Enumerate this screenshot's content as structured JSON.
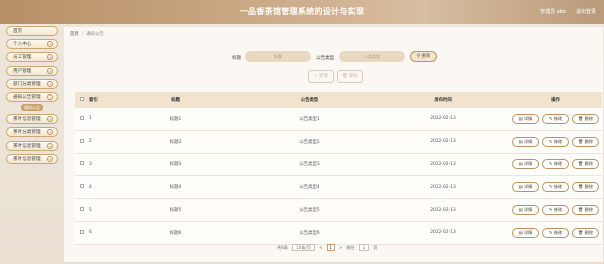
{
  "header": {
    "title": "一品香茶馆管理系统的设计与实现",
    "user": "管理员 abo",
    "logout": "退出登录"
  },
  "sidebar": {
    "items": [
      {
        "label": "首页"
      },
      {
        "label": "个人中心"
      },
      {
        "label": "员工管理"
      },
      {
        "label": "用户管理"
      },
      {
        "label": "部门分类管理"
      },
      {
        "label": "通知公告管理"
      }
    ],
    "active_sub": "通知公告",
    "items_after": [
      {
        "label": "茶叶信息管理"
      },
      {
        "label": "茶叶分类管理"
      },
      {
        "label": "茶叶信息管理"
      },
      {
        "label": "茶叶信息管理"
      }
    ]
  },
  "breadcrumb": {
    "home": "首页",
    "current": "通知公告"
  },
  "search": {
    "title_label": "标题",
    "title_placeholder": "标题",
    "type_label": "公告类型",
    "type_placeholder": "公告类型",
    "query_button": "查询"
  },
  "actions": {
    "add": "新增",
    "delete": "删除"
  },
  "table": {
    "columns": {
      "index": "索引",
      "title": "标题",
      "type": "公告类型",
      "time": "发布时间",
      "ops": "操作"
    },
    "rows": [
      {
        "index": "1",
        "title": "标题1",
        "type": "公告类型1",
        "time": "2022-02-13"
      },
      {
        "index": "2",
        "title": "标题2",
        "type": "公告类型2",
        "time": "2022-02-13"
      },
      {
        "index": "3",
        "title": "标题3",
        "type": "公告类型3",
        "time": "2022-02-13"
      },
      {
        "index": "4",
        "title": "标题4",
        "type": "公告类型4",
        "time": "2022-02-13"
      },
      {
        "index": "5",
        "title": "标题5",
        "type": "公告类型5",
        "time": "2022-02-13"
      },
      {
        "index": "6",
        "title": "标题6",
        "type": "公告类型6",
        "time": "2022-02-13"
      }
    ],
    "ops": {
      "detail": "详情",
      "edit": "修改",
      "remove": "删除"
    }
  },
  "pager": {
    "total": "共6条",
    "page_size": "10条/页",
    "prev": "<",
    "page": "1",
    "next": ">",
    "goto_label": "前往",
    "goto_value": "1",
    "page_unit": "页"
  }
}
